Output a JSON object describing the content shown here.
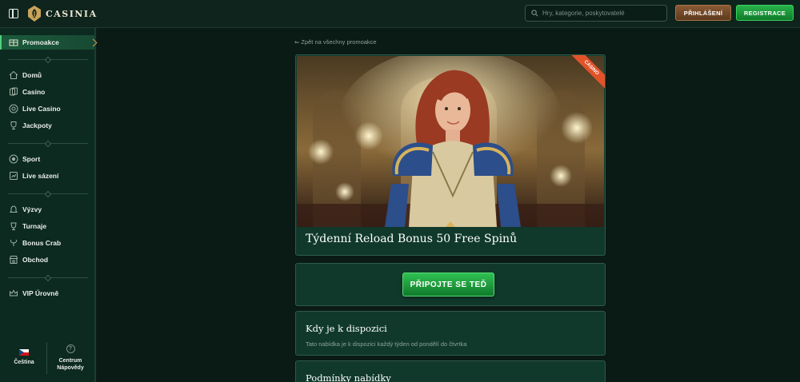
{
  "header": {
    "logo_text": "CASINIA",
    "search_placeholder": "Hry, kategorie, poskytovatelé",
    "login_label": "PŘIHLÁŠENÍ",
    "register_label": "REGISTRACE"
  },
  "sidebar": {
    "promo": "Promoakce",
    "items_main": [
      "Domů",
      "Casino",
      "Live Casino",
      "Jackpoty"
    ],
    "items_sport": [
      "Sport",
      "Live sázení"
    ],
    "items_extra": [
      "Výzvy",
      "Turnaje",
      "Bonus Crab",
      "Obchod"
    ],
    "items_vip": [
      "VIP Úrovně"
    ],
    "language": "Čeština",
    "help_line1": "Centrum",
    "help_line2": "Nápovědy",
    "help_icon": "?"
  },
  "main": {
    "back_link": "⇐ Zpět na všechny promoakce",
    "ribbon": "CASINO",
    "promo_title": "Týdenní Reload Bonus 50 Free Spinů",
    "join_label": "PŘIPOJTE SE TEĎ",
    "availability_title": "Kdy je k dispozici",
    "availability_text": "Tato nabídka je k dispozici každý týden od pondělí do čtvrtka",
    "terms_title": "Podmínky nabídky"
  },
  "colors": {
    "accent_green": "#29b34a",
    "login_brown": "#8a5a34",
    "ribbon_orange": "#e2532a",
    "card_bg": "#10392c"
  }
}
